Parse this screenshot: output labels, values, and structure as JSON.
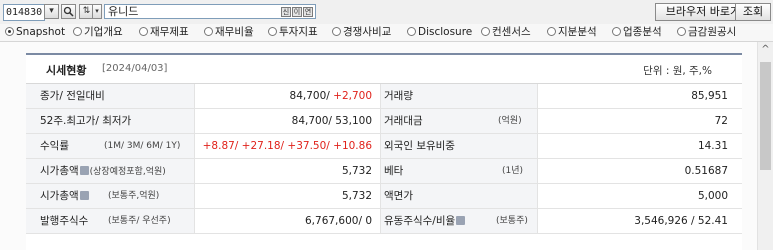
{
  "toolbar": {
    "code": "014830",
    "name": "유니드",
    "browser_btn": "브라우저 바로가기",
    "query_btn": "조회",
    "mini_btns": [
      "신",
      "이",
      "연"
    ]
  },
  "tabs": [
    {
      "label": "Snapshot",
      "selected": true
    },
    {
      "label": "기업개요",
      "selected": false
    },
    {
      "label": "재무제표",
      "selected": false
    },
    {
      "label": "재무비율",
      "selected": false
    },
    {
      "label": "투자지표",
      "selected": false
    },
    {
      "label": "경쟁사비교",
      "selected": false
    },
    {
      "label": "Disclosure",
      "selected": false
    },
    {
      "label": "컨센서스",
      "selected": false
    },
    {
      "label": "지분분석",
      "selected": false
    },
    {
      "label": "업종분석",
      "selected": false
    },
    {
      "label": "금감원공시",
      "selected": false
    }
  ],
  "panel": {
    "title": "시세현황",
    "date": "[2024/04/03]",
    "unit": "단위 : 원, 주,%"
  },
  "rows": [
    {
      "left_label": "종가/ 전일대비",
      "left_sub": "",
      "left_value": "84,700/",
      "left_value_red": "+2,700",
      "right_label": "거래량",
      "right_sub": "",
      "right_value": "85,951"
    },
    {
      "left_label": "52주.최고가/ 최저가",
      "left_sub": "",
      "left_value": "84,700/ 53,100",
      "left_value_red": "",
      "right_label": "거래대금",
      "right_sub": "(억원)",
      "right_value": "72"
    },
    {
      "left_label": "수익률",
      "left_sub": "(1M/ 3M/ 6M/ 1Y)",
      "left_value": "",
      "left_value_red": "+8.87/ +27.18/ +37.50/ +10.86",
      "right_label": "외국인 보유비중",
      "right_sub": "",
      "right_value": "14.31"
    },
    {
      "left_label": "시가총액",
      "left_sub": "(상장예정포함,억원)",
      "left_value": "5,732",
      "left_value_red": "",
      "right_label": "베타",
      "right_sub": "(1년)",
      "right_value": "0.51687"
    },
    {
      "left_label": "시가총액",
      "left_sub": "(보통주,억원)",
      "left_value": "5,732",
      "left_value_red": "",
      "right_label": "액면가",
      "right_sub": "",
      "right_value": "5,000"
    },
    {
      "left_label": "발행주식수",
      "left_sub": "(보통주/ 우선주)",
      "left_value": "6,767,600/ 0",
      "left_value_red": "",
      "right_label": "유동주식수/비율",
      "right_sub": "(보통주)",
      "right_value": "3,546,926 / 52.41"
    }
  ]
}
